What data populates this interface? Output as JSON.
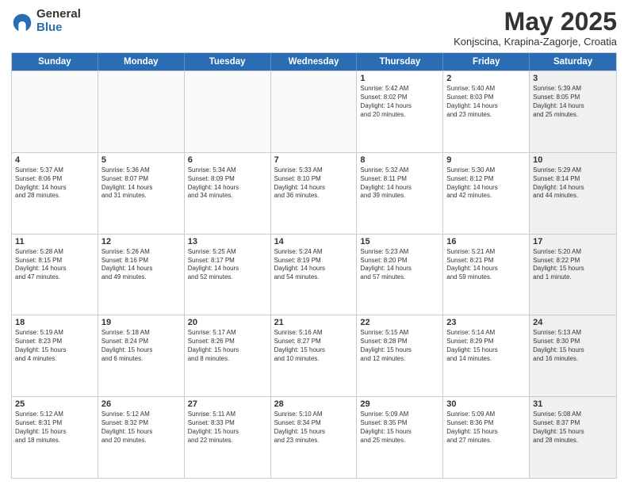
{
  "logo": {
    "general": "General",
    "blue": "Blue"
  },
  "title": "May 2025",
  "subtitle": "Konjscina, Krapina-Zagorje, Croatia",
  "headers": [
    "Sunday",
    "Monday",
    "Tuesday",
    "Wednesday",
    "Thursday",
    "Friday",
    "Saturday"
  ],
  "weeks": [
    [
      {
        "day": "",
        "text": "",
        "empty": true
      },
      {
        "day": "",
        "text": "",
        "empty": true
      },
      {
        "day": "",
        "text": "",
        "empty": true
      },
      {
        "day": "",
        "text": "",
        "empty": true
      },
      {
        "day": "1",
        "text": "Sunrise: 5:42 AM\nSunset: 8:02 PM\nDaylight: 14 hours\nand 20 minutes.",
        "empty": false
      },
      {
        "day": "2",
        "text": "Sunrise: 5:40 AM\nSunset: 8:03 PM\nDaylight: 14 hours\nand 23 minutes.",
        "empty": false
      },
      {
        "day": "3",
        "text": "Sunrise: 5:39 AM\nSunset: 8:05 PM\nDaylight: 14 hours\nand 25 minutes.",
        "empty": false,
        "shaded": true
      }
    ],
    [
      {
        "day": "4",
        "text": "Sunrise: 5:37 AM\nSunset: 8:06 PM\nDaylight: 14 hours\nand 28 minutes.",
        "empty": false
      },
      {
        "day": "5",
        "text": "Sunrise: 5:36 AM\nSunset: 8:07 PM\nDaylight: 14 hours\nand 31 minutes.",
        "empty": false
      },
      {
        "day": "6",
        "text": "Sunrise: 5:34 AM\nSunset: 8:09 PM\nDaylight: 14 hours\nand 34 minutes.",
        "empty": false
      },
      {
        "day": "7",
        "text": "Sunrise: 5:33 AM\nSunset: 8:10 PM\nDaylight: 14 hours\nand 36 minutes.",
        "empty": false
      },
      {
        "day": "8",
        "text": "Sunrise: 5:32 AM\nSunset: 8:11 PM\nDaylight: 14 hours\nand 39 minutes.",
        "empty": false
      },
      {
        "day": "9",
        "text": "Sunrise: 5:30 AM\nSunset: 8:12 PM\nDaylight: 14 hours\nand 42 minutes.",
        "empty": false
      },
      {
        "day": "10",
        "text": "Sunrise: 5:29 AM\nSunset: 8:14 PM\nDaylight: 14 hours\nand 44 minutes.",
        "empty": false,
        "shaded": true
      }
    ],
    [
      {
        "day": "11",
        "text": "Sunrise: 5:28 AM\nSunset: 8:15 PM\nDaylight: 14 hours\nand 47 minutes.",
        "empty": false
      },
      {
        "day": "12",
        "text": "Sunrise: 5:26 AM\nSunset: 8:16 PM\nDaylight: 14 hours\nand 49 minutes.",
        "empty": false
      },
      {
        "day": "13",
        "text": "Sunrise: 5:25 AM\nSunset: 8:17 PM\nDaylight: 14 hours\nand 52 minutes.",
        "empty": false
      },
      {
        "day": "14",
        "text": "Sunrise: 5:24 AM\nSunset: 8:19 PM\nDaylight: 14 hours\nand 54 minutes.",
        "empty": false
      },
      {
        "day": "15",
        "text": "Sunrise: 5:23 AM\nSunset: 8:20 PM\nDaylight: 14 hours\nand 57 minutes.",
        "empty": false
      },
      {
        "day": "16",
        "text": "Sunrise: 5:21 AM\nSunset: 8:21 PM\nDaylight: 14 hours\nand 59 minutes.",
        "empty": false
      },
      {
        "day": "17",
        "text": "Sunrise: 5:20 AM\nSunset: 8:22 PM\nDaylight: 15 hours\nand 1 minute.",
        "empty": false,
        "shaded": true
      }
    ],
    [
      {
        "day": "18",
        "text": "Sunrise: 5:19 AM\nSunset: 8:23 PM\nDaylight: 15 hours\nand 4 minutes.",
        "empty": false
      },
      {
        "day": "19",
        "text": "Sunrise: 5:18 AM\nSunset: 8:24 PM\nDaylight: 15 hours\nand 6 minutes.",
        "empty": false
      },
      {
        "day": "20",
        "text": "Sunrise: 5:17 AM\nSunset: 8:26 PM\nDaylight: 15 hours\nand 8 minutes.",
        "empty": false
      },
      {
        "day": "21",
        "text": "Sunrise: 5:16 AM\nSunset: 8:27 PM\nDaylight: 15 hours\nand 10 minutes.",
        "empty": false
      },
      {
        "day": "22",
        "text": "Sunrise: 5:15 AM\nSunset: 8:28 PM\nDaylight: 15 hours\nand 12 minutes.",
        "empty": false
      },
      {
        "day": "23",
        "text": "Sunrise: 5:14 AM\nSunset: 8:29 PM\nDaylight: 15 hours\nand 14 minutes.",
        "empty": false
      },
      {
        "day": "24",
        "text": "Sunrise: 5:13 AM\nSunset: 8:30 PM\nDaylight: 15 hours\nand 16 minutes.",
        "empty": false,
        "shaded": true
      }
    ],
    [
      {
        "day": "25",
        "text": "Sunrise: 5:12 AM\nSunset: 8:31 PM\nDaylight: 15 hours\nand 18 minutes.",
        "empty": false
      },
      {
        "day": "26",
        "text": "Sunrise: 5:12 AM\nSunset: 8:32 PM\nDaylight: 15 hours\nand 20 minutes.",
        "empty": false
      },
      {
        "day": "27",
        "text": "Sunrise: 5:11 AM\nSunset: 8:33 PM\nDaylight: 15 hours\nand 22 minutes.",
        "empty": false
      },
      {
        "day": "28",
        "text": "Sunrise: 5:10 AM\nSunset: 8:34 PM\nDaylight: 15 hours\nand 23 minutes.",
        "empty": false
      },
      {
        "day": "29",
        "text": "Sunrise: 5:09 AM\nSunset: 8:35 PM\nDaylight: 15 hours\nand 25 minutes.",
        "empty": false
      },
      {
        "day": "30",
        "text": "Sunrise: 5:09 AM\nSunset: 8:36 PM\nDaylight: 15 hours\nand 27 minutes.",
        "empty": false
      },
      {
        "day": "31",
        "text": "Sunrise: 5:08 AM\nSunset: 8:37 PM\nDaylight: 15 hours\nand 28 minutes.",
        "empty": false,
        "shaded": true
      }
    ]
  ]
}
